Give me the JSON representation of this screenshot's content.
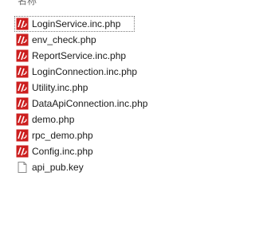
{
  "header": {
    "name_column": "名称"
  },
  "files": [
    {
      "name": "LoginService.inc.php",
      "icon": "php-file-icon",
      "selected": true
    },
    {
      "name": "env_check.php",
      "icon": "php-file-icon",
      "selected": false
    },
    {
      "name": "ReportService.inc.php",
      "icon": "php-file-icon",
      "selected": false
    },
    {
      "name": "LoginConnection.inc.php",
      "icon": "php-file-icon",
      "selected": false
    },
    {
      "name": "Utility.inc.php",
      "icon": "php-file-icon",
      "selected": false
    },
    {
      "name": "DataApiConnection.inc.php",
      "icon": "php-file-icon",
      "selected": false
    },
    {
      "name": "demo.php",
      "icon": "php-file-icon",
      "selected": false
    },
    {
      "name": "rpc_demo.php",
      "icon": "php-file-icon",
      "selected": false
    },
    {
      "name": "Config.inc.php",
      "icon": "php-file-icon",
      "selected": false
    },
    {
      "name": "api_pub.key",
      "icon": "generic-file-icon",
      "selected": false
    }
  ],
  "colors": {
    "php_icon_red": "#cc1f1f",
    "text": "#1a1a1a",
    "header_text": "#6d6d6d"
  }
}
